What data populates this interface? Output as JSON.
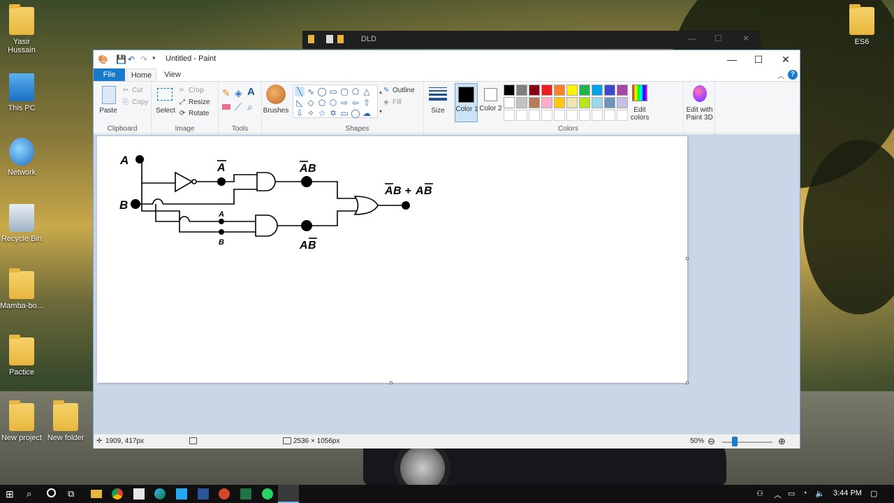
{
  "desktop": {
    "icons": [
      {
        "label": "Yasir Hussain",
        "icon": "user-folder-icon"
      },
      {
        "label": "This PC",
        "icon": "computer-icon"
      },
      {
        "label": "Network",
        "icon": "network-icon"
      },
      {
        "label": "Recycle Bin",
        "icon": "recycle-bin-icon"
      },
      {
        "label": "Mamba-bo...",
        "icon": "folder-icon"
      },
      {
        "label": "Pactice",
        "icon": "chrome-folder-icon"
      },
      {
        "label": "New project",
        "icon": "folder-icon"
      },
      {
        "label": "New folder",
        "icon": "folder-icon"
      },
      {
        "label": "ES6",
        "icon": "folder-icon"
      }
    ]
  },
  "background_window": {
    "title": "DLD"
  },
  "paint": {
    "title": "Untitled - Paint",
    "tabs": [
      "File",
      "Home",
      "View"
    ],
    "active_tab": "Home",
    "ribbon": {
      "clipboard": {
        "paste": "Paste",
        "cut": "Cut",
        "copy": "Copy",
        "group": "Clipboard"
      },
      "image": {
        "select": "Select",
        "crop": "Crop",
        "resize": "Resize",
        "rotate": "Rotate",
        "group": "Image"
      },
      "tools": {
        "group": "Tools"
      },
      "brushes": {
        "label": "Brushes"
      },
      "shapes": {
        "outline": "Outline",
        "fill": "Fill",
        "group": "Shapes"
      },
      "size": {
        "label": "Size"
      },
      "colors": {
        "color1": "Color 1",
        "color1_value": "#000000",
        "color2": "Color 2",
        "color2_value": "#ffffff",
        "edit_colors": "Edit colors",
        "group": "Colors",
        "palette_row1": [
          "#000000",
          "#7f7f7f",
          "#880015",
          "#ed1c24",
          "#ff7f27",
          "#fff200",
          "#22b14c",
          "#00a2e8",
          "#3f48cc",
          "#a349a4"
        ],
        "palette_row2": [
          "#ffffff",
          "#c3c3c3",
          "#b97a57",
          "#ffaec9",
          "#ffc90e",
          "#efe4b0",
          "#b5e61d",
          "#99d9ea",
          "#7092be",
          "#c8bfe7"
        ]
      },
      "paint3d": {
        "label": "Edit with Paint 3D"
      }
    },
    "canvas": {
      "labels": {
        "input_a": "A",
        "input_b": "B",
        "not_a": "A",
        "and1_out_a": "A",
        "and1_out_b": "B",
        "and2_in_a": "A",
        "and2_in_b": "B",
        "and2_out_a": "A",
        "and2_out_b": "B",
        "or_out_a": "A",
        "or_out_b": "B",
        "or_out_mid": " + ",
        "or_out_a2": "A",
        "or_out_b2": "B"
      }
    },
    "status": {
      "cursor": "1909, 417px",
      "size": "2536 × 1056px",
      "zoom": "50%"
    }
  },
  "taskbar": {
    "time": "3:44 PM"
  }
}
